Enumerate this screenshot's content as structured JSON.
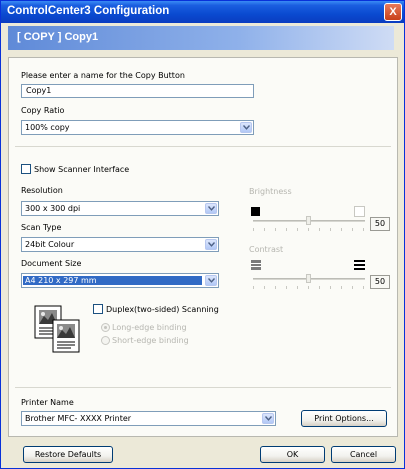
{
  "window": {
    "title": "ControlCenter3 Configuration",
    "close_glyph": "X"
  },
  "header": {
    "text": "[ COPY ]   Copy1"
  },
  "copy_name": {
    "label": "Please enter a name for the Copy Button",
    "value": "Copy1"
  },
  "copy_ratio": {
    "label": "Copy Ratio",
    "value": "100% copy"
  },
  "scanner_interface": {
    "label": "Show Scanner Interface",
    "checked": false
  },
  "resolution": {
    "label": "Resolution",
    "value": "300 x 300 dpi"
  },
  "scan_type": {
    "label": "Scan Type",
    "value": "24bit Colour"
  },
  "document_size": {
    "label": "Document Size",
    "value": "A4 210 x 297 mm"
  },
  "duplex": {
    "label": "Duplex(two-sided) Scanning",
    "checked": false,
    "options": [
      "Long-edge binding",
      "Short-edge binding"
    ],
    "selected": "Long-edge binding",
    "enabled": false
  },
  "brightness": {
    "label": "Brightness",
    "value": "50",
    "level_fraction": 0.5,
    "enabled": false
  },
  "contrast": {
    "label": "Contrast",
    "value": "50",
    "level_fraction": 0.5,
    "enabled": false
  },
  "printer": {
    "label": "Printer Name",
    "value": "Brother MFC- XXXX    Printer",
    "options_button": "Print Options..."
  },
  "footer": {
    "restore": "Restore Defaults",
    "ok": "OK",
    "cancel": "Cancel"
  },
  "colors": {
    "title_blue": "#0a4ad0",
    "header_blue": "#5f8ad8",
    "selection": "#316ac5"
  }
}
